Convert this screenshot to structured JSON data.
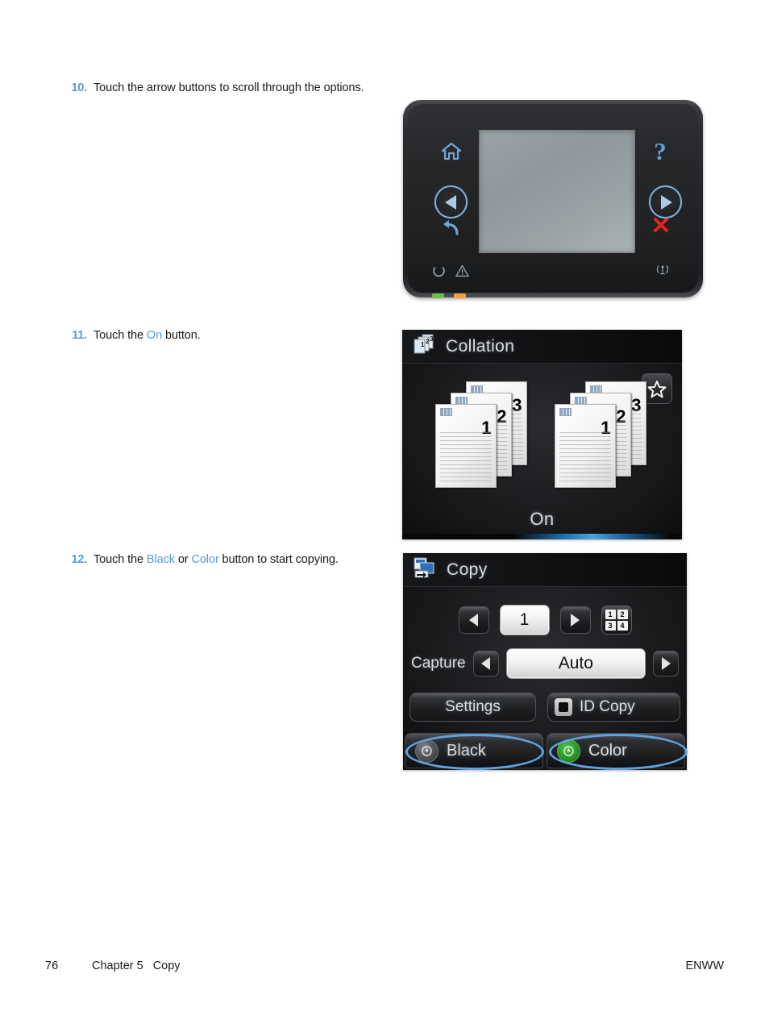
{
  "colors": {
    "accent_blue": "#5b9bd5",
    "callout_blue": "#5ea3dd",
    "cancel_red": "#e8221e",
    "led_green": "#6abf4b",
    "led_amber": "#f0a33c",
    "start_color_green": "#2f9a2b"
  },
  "steps": [
    {
      "number": "10.",
      "parts": [
        {
          "text": "Touch the arrow buttons to scroll through the options.",
          "highlight": false
        }
      ]
    },
    {
      "number": "11.",
      "parts": [
        {
          "text": "Touch the ",
          "highlight": false
        },
        {
          "text": "On",
          "highlight": true
        },
        {
          "text": " button.",
          "highlight": false
        }
      ]
    },
    {
      "number": "12.",
      "parts": [
        {
          "text": "Touch the ",
          "highlight": false
        },
        {
          "text": "Black",
          "highlight": true
        },
        {
          "text": " or ",
          "highlight": false
        },
        {
          "text": "Color",
          "highlight": true
        },
        {
          "text": " button to start copying.",
          "highlight": false
        }
      ]
    }
  ],
  "control_panel": {
    "icons": {
      "home": "home-icon",
      "back": "back-arrow-icon",
      "help": "?",
      "cancel": "✕",
      "left_arrow": "left-arrow-icon",
      "right_arrow": "right-arrow-icon",
      "ready": "ready-circle-icon",
      "attention": "attention-triangle-icon",
      "wireless": "wireless-icon"
    },
    "leds": [
      {
        "name": "ready-led",
        "color": "#6abf4b"
      },
      {
        "name": "attention-led",
        "color": "#f0a33c"
      }
    ]
  },
  "collation_screen": {
    "title": "Collation",
    "title_icon": "collated-pages-icon",
    "favorite_icon": "star-icon",
    "stacks": [
      {
        "pages": [
          "1",
          "2",
          "3"
        ]
      },
      {
        "pages": [
          "1",
          "2",
          "3"
        ]
      }
    ],
    "value": "On"
  },
  "copy_screen": {
    "title": "Copy",
    "title_icon": "copy-document-icon",
    "copy_count": "1",
    "decrement_icon": "left-arrow-icon",
    "increment_icon": "right-arrow-icon",
    "keypad_icon": "numeric-keypad-icon",
    "keypad_keys": [
      "1",
      "2",
      "3",
      "4"
    ],
    "capture_label": "Capture",
    "capture_value": "Auto",
    "capture_prev_icon": "left-arrow-icon",
    "capture_next_icon": "right-arrow-icon",
    "settings_label": "Settings",
    "id_copy_label": "ID Copy",
    "id_copy_icon": "id-card-icon",
    "black_label": "Black",
    "color_label": "Color",
    "start_icon": "start-power-icon"
  },
  "footer": {
    "page_number": "76",
    "chapter": "Chapter 5",
    "section": "Copy",
    "language_code": "ENWW"
  }
}
